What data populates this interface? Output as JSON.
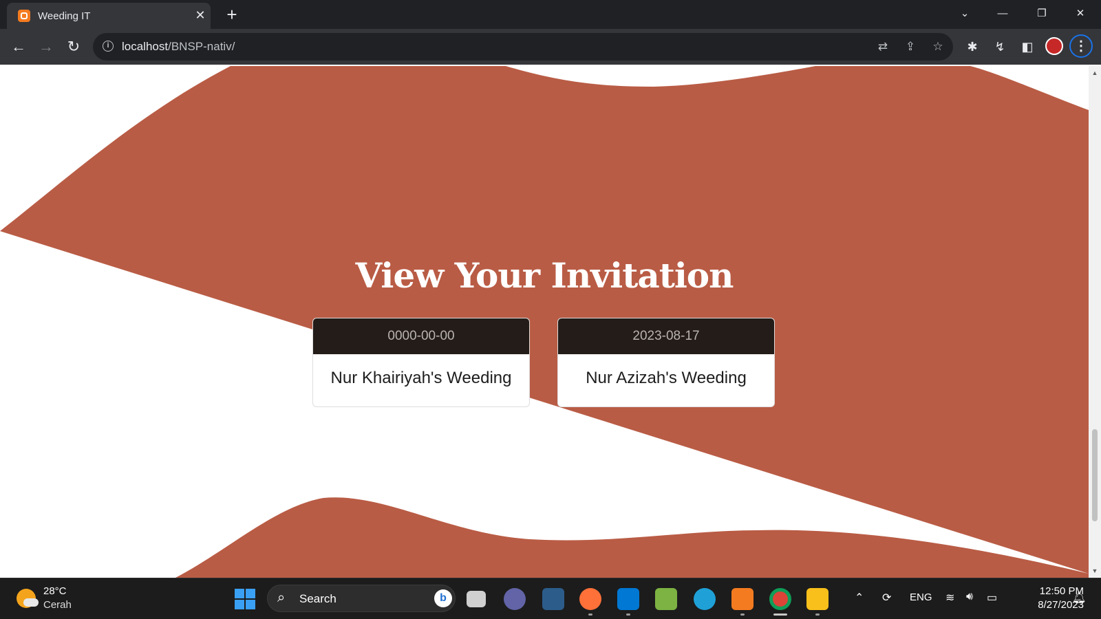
{
  "browser": {
    "tab_title": "Weeding IT",
    "url_host": "localhost",
    "url_path": "/BNSP-nativ/"
  },
  "page": {
    "section_title": "View Your Invitation",
    "background_color": "#b95c45",
    "invitations": [
      {
        "date": "0000-00-00",
        "name": "Nur Khairiyah's Weeding"
      },
      {
        "date": "2023-08-17",
        "name": "Nur Azizah's Weeding"
      }
    ]
  },
  "taskbar": {
    "weather_temp": "28°C",
    "weather_condition": "Cerah",
    "search_placeholder": "Search",
    "language": "ENG",
    "time": "12:50 PM",
    "date": "8/27/2023",
    "apps": [
      "task-view",
      "teams",
      "mysql-workbench",
      "firefox",
      "vscode",
      "notepad-plus-plus",
      "edge",
      "xampp",
      "chrome",
      "file-explorer"
    ]
  }
}
